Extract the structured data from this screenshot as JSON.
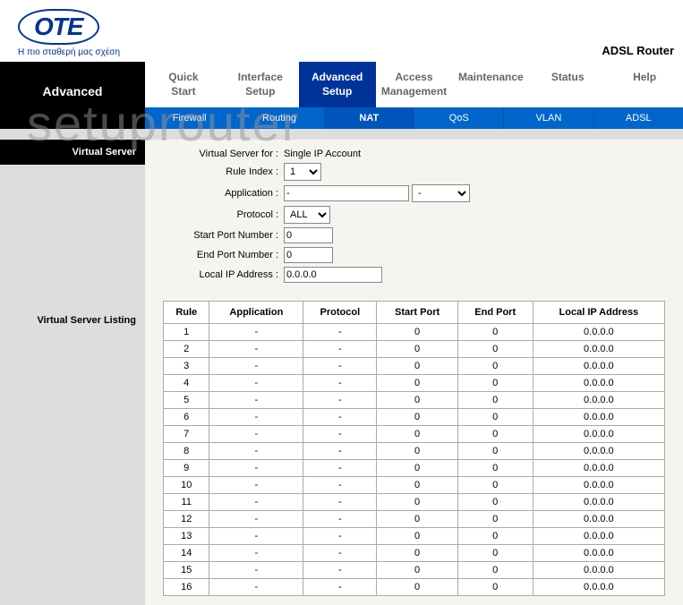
{
  "header": {
    "logo_text": "OTE",
    "tagline": "Η πιο σταθερή μας σχέση",
    "product": "ADSL Router"
  },
  "nav": {
    "main_tabs": [
      {
        "label": "Quick\nStart"
      },
      {
        "label": "Interface\nSetup"
      },
      {
        "label": "Advanced\nSetup"
      },
      {
        "label": "Access\nManagement"
      },
      {
        "label": "Maintenance"
      },
      {
        "label": "Status"
      },
      {
        "label": "Help"
      }
    ],
    "sub_tabs": [
      {
        "label": "Firewall"
      },
      {
        "label": "Routing"
      },
      {
        "label": "NAT"
      },
      {
        "label": "QoS"
      },
      {
        "label": "VLAN"
      },
      {
        "label": "ADSL"
      }
    ],
    "left_title": "Advanced",
    "section_virtual_server": "Virtual Server",
    "section_listing": "Virtual Server Listing"
  },
  "form": {
    "vs_for_label": "Virtual Server for :",
    "vs_for_value": "Single IP Account",
    "rule_index_label": "Rule Index :",
    "rule_index_value": "1",
    "application_label": "Application :",
    "application_value": "-",
    "application_select": "-",
    "protocol_label": "Protocol :",
    "protocol_value": "ALL",
    "start_port_label": "Start Port Number :",
    "start_port_value": "0",
    "end_port_label": "End Port Number :",
    "end_port_value": "0",
    "local_ip_label": "Local IP Address :",
    "local_ip_value": "0.0.0.0"
  },
  "table": {
    "headers": {
      "rule": "Rule",
      "application": "Application",
      "protocol": "Protocol",
      "start_port": "Start Port",
      "end_port": "End Port",
      "local_ip": "Local IP Address"
    },
    "rows": [
      {
        "rule": "1",
        "app": "-",
        "proto": "-",
        "sp": "0",
        "ep": "0",
        "ip": "0.0.0.0"
      },
      {
        "rule": "2",
        "app": "-",
        "proto": "-",
        "sp": "0",
        "ep": "0",
        "ip": "0.0.0.0"
      },
      {
        "rule": "3",
        "app": "-",
        "proto": "-",
        "sp": "0",
        "ep": "0",
        "ip": "0.0.0.0"
      },
      {
        "rule": "4",
        "app": "-",
        "proto": "-",
        "sp": "0",
        "ep": "0",
        "ip": "0.0.0.0"
      },
      {
        "rule": "5",
        "app": "-",
        "proto": "-",
        "sp": "0",
        "ep": "0",
        "ip": "0.0.0.0"
      },
      {
        "rule": "6",
        "app": "-",
        "proto": "-",
        "sp": "0",
        "ep": "0",
        "ip": "0.0.0.0"
      },
      {
        "rule": "7",
        "app": "-",
        "proto": "-",
        "sp": "0",
        "ep": "0",
        "ip": "0.0.0.0"
      },
      {
        "rule": "8",
        "app": "-",
        "proto": "-",
        "sp": "0",
        "ep": "0",
        "ip": "0.0.0.0"
      },
      {
        "rule": "9",
        "app": "-",
        "proto": "-",
        "sp": "0",
        "ep": "0",
        "ip": "0.0.0.0"
      },
      {
        "rule": "10",
        "app": "-",
        "proto": "-",
        "sp": "0",
        "ep": "0",
        "ip": "0.0.0.0"
      },
      {
        "rule": "11",
        "app": "-",
        "proto": "-",
        "sp": "0",
        "ep": "0",
        "ip": "0.0.0.0"
      },
      {
        "rule": "12",
        "app": "-",
        "proto": "-",
        "sp": "0",
        "ep": "0",
        "ip": "0.0.0.0"
      },
      {
        "rule": "13",
        "app": "-",
        "proto": "-",
        "sp": "0",
        "ep": "0",
        "ip": "0.0.0.0"
      },
      {
        "rule": "14",
        "app": "-",
        "proto": "-",
        "sp": "0",
        "ep": "0",
        "ip": "0.0.0.0"
      },
      {
        "rule": "15",
        "app": "-",
        "proto": "-",
        "sp": "0",
        "ep": "0",
        "ip": "0.0.0.0"
      },
      {
        "rule": "16",
        "app": "-",
        "proto": "-",
        "sp": "0",
        "ep": "0",
        "ip": "0.0.0.0"
      }
    ]
  },
  "watermark": "setuprouter"
}
